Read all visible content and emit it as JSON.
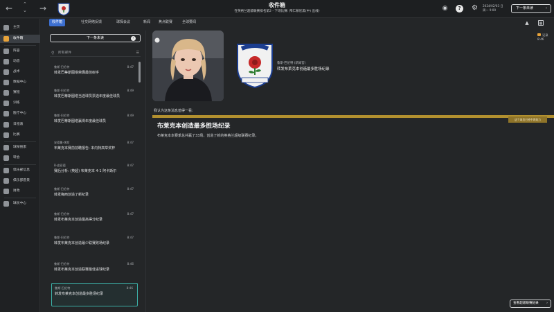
{
  "topbar": {
    "title": "收件箱",
    "subtitle": "在英格兰超级联赛排名第2 - 下场比赛: 拜仁慕尼黑(中) 出线)",
    "date_line1": "2024/02/03 日",
    "date_line2": "周一 9:00",
    "continue_label": "下一条未读"
  },
  "sidebar": {
    "items": [
      {
        "label": "主页"
      },
      {
        "label": "收件箱"
      },
      {
        "label": "阵容"
      },
      {
        "label": "动态"
      },
      {
        "label": "战术"
      },
      {
        "label": "数据中心"
      },
      {
        "label": "赛程"
      },
      {
        "label": "训练"
      },
      {
        "label": "医疗中心"
      },
      {
        "label": "日程表"
      },
      {
        "label": "比赛"
      },
      {
        "label": "球探搜索"
      },
      {
        "label": "转会"
      },
      {
        "label": "俱乐部信息"
      },
      {
        "label": "俱乐部愿景"
      },
      {
        "label": "财政"
      },
      {
        "label": "球员中心"
      }
    ]
  },
  "tabs": [
    {
      "label": "收件箱"
    },
    {
      "label": "社交网络反馈"
    },
    {
      "label": "球探会议"
    },
    {
      "label": "新闻"
    },
    {
      "label": "焦点联赛"
    },
    {
      "label": "全球要闻"
    }
  ],
  "inbox": {
    "reply_label": "下一条未读",
    "filter_placeholder": "所有邮件",
    "messages": [
      {
        "sender": "鲁斯·巴伦特",
        "time": "8:47",
        "subject": "转发巴蒂斯图塔荣膺最佳射手"
      },
      {
        "sender": "鲁斯·巴伦特",
        "time": "8:49",
        "subject": "转发巴蒂斯图塔当选球员票选年度最佳球员"
      },
      {
        "sender": "鲁斯·巴伦特",
        "time": "8:49",
        "subject": "转发巴蒂斯图塔赢得年度最佳球员"
      },
      {
        "sender": "安德鲁·休斯",
        "time": "8:47",
        "subject": "布莱克本赛前前瞻报告: 本内特高举奖杯"
      },
      {
        "sender": "B·皮亚德",
        "time": "8:47",
        "subject": "赛后分析: (英超) 布莱克本 4-1 阿卡斯尔"
      },
      {
        "sender": "鲁斯·巴伦特",
        "time": "8:47",
        "subject": "转发梅西创造了新纪录"
      },
      {
        "sender": "鲁斯·巴伦特",
        "time": "8:47",
        "subject": "转发布莱克本创造最高得分纪录"
      },
      {
        "sender": "鲁斯·巴伦特",
        "time": "8:47",
        "subject": "转发布莱克本创造最少联赛败场纪录"
      },
      {
        "sender": "鲁斯·巴伦特",
        "time": "8:46",
        "subject": "转发布莱克本创造联赛最佳进球纪录"
      },
      {
        "sender": "鲁斯·巴伦特",
        "time": "8:46",
        "subject": "转发布莱克本创造最多胜场纪录"
      }
    ]
  },
  "message": {
    "from": "鲁斯·巴伦特 (新闻官)",
    "title": "转发布莱克本创造最多胜场纪录",
    "like_label": "记录",
    "like_time": "8:46",
    "prompt": "我认为这条消息值得一看:",
    "gold_tag": "这个球员已经不再效力",
    "headline": "布莱克本创造最多胜场纪录",
    "body": "布莱克本本赛季总共赢了33场，创造了新的英格兰超级联赛纪录。",
    "bottom_button": "查看超级联赛纪录",
    "crest_motto": "ARTE ET LABORE",
    "crest_top": "BLACKBURN ROVERS"
  },
  "colors": {
    "accent_tab": "#3c6fd0",
    "gold": "#b2902f",
    "orange": "#e8a33a",
    "selected_border": "#3cb1a8"
  }
}
